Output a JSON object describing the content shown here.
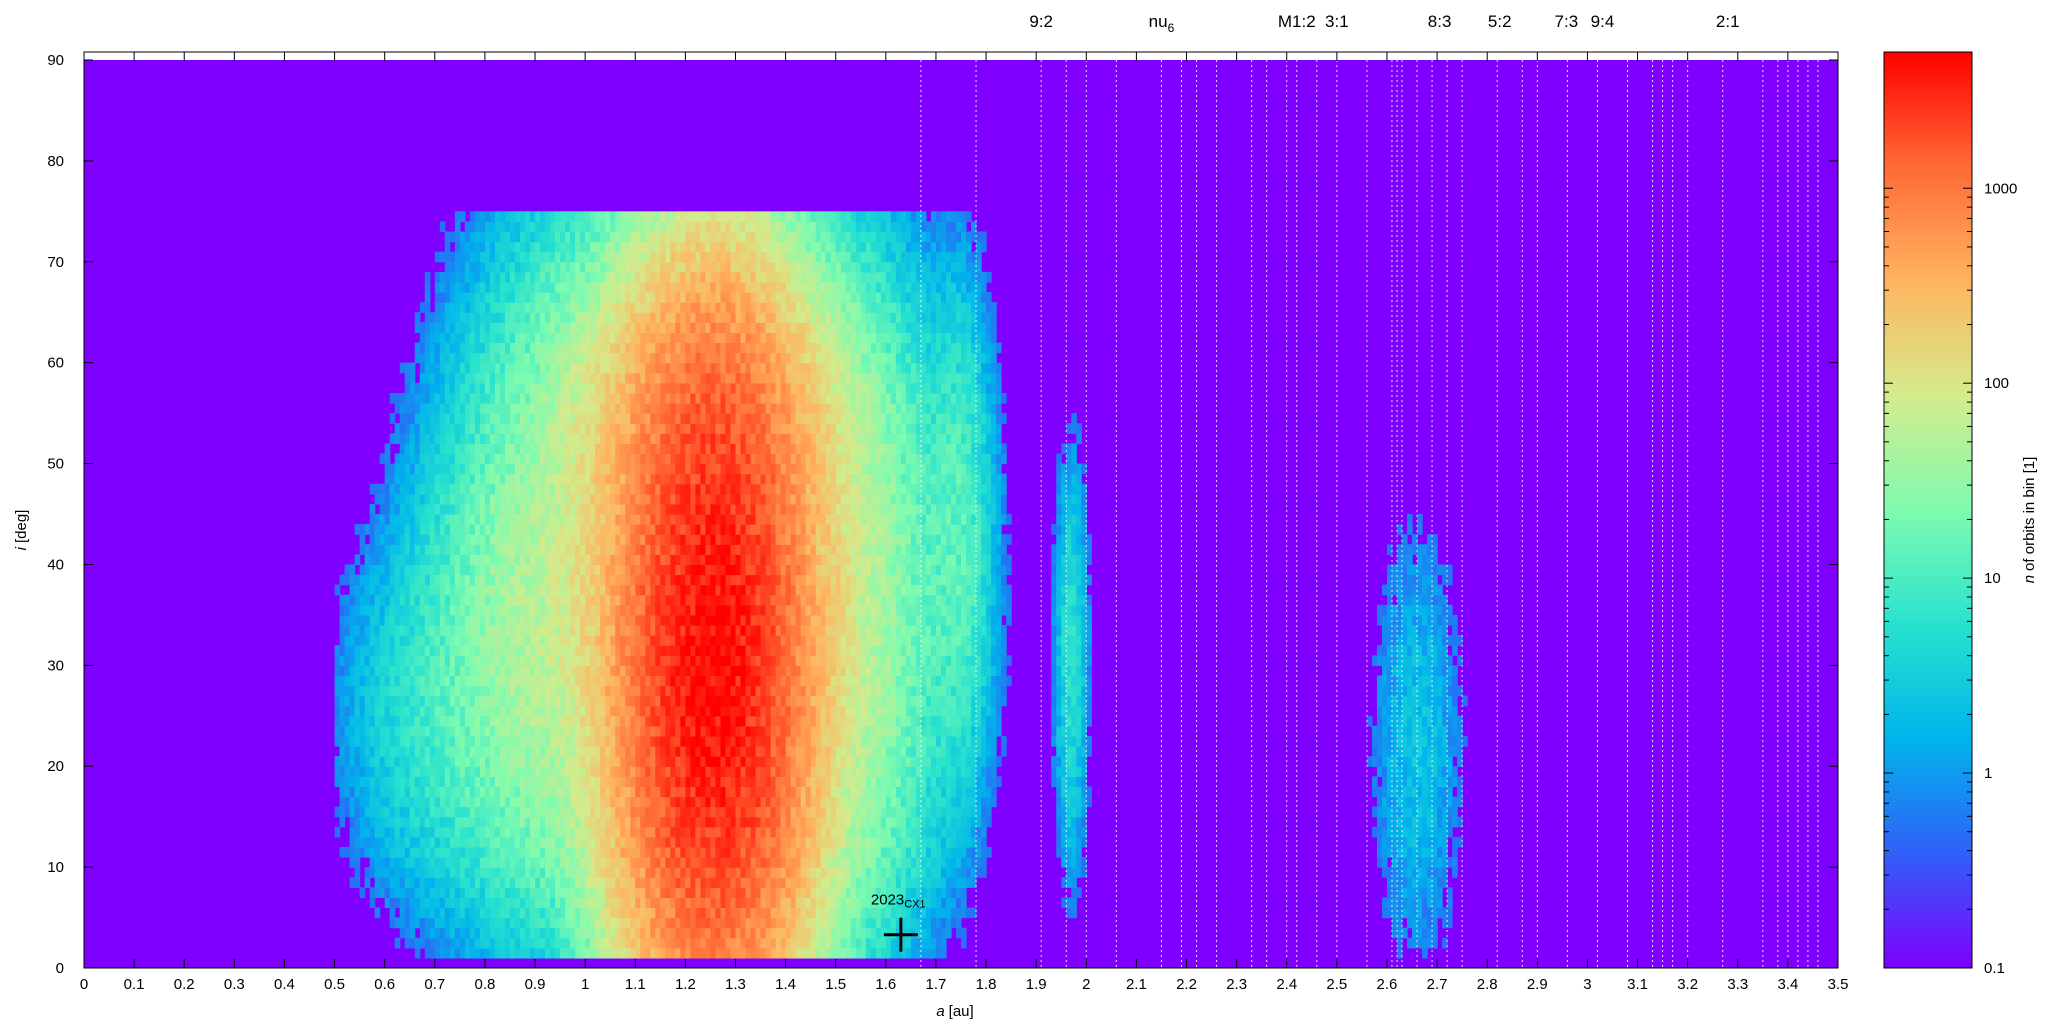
{
  "chart_data": {
    "type": "heatmap",
    "xlabel_var": "a",
    "xlabel_unit": "[au]",
    "ylabel_var": "i",
    "ylabel_unit": "[deg]",
    "colorbar_label_var": "n",
    "colorbar_label_text": "of orbits in bin [1]",
    "xlim": [
      0,
      3.5
    ],
    "ylim": [
      0,
      90
    ],
    "x_ticks": [
      "0",
      "0.1",
      "0.2",
      "0.3",
      "0.4",
      "0.5",
      "0.6",
      "0.7",
      "0.8",
      "0.9",
      "1",
      "1.1",
      "1.2",
      "1.3",
      "1.4",
      "1.5",
      "1.6",
      "1.7",
      "1.8",
      "1.9",
      "2",
      "2.1",
      "2.2",
      "2.3",
      "2.4",
      "2.5",
      "2.6",
      "2.7",
      "2.8",
      "2.9",
      "3",
      "3.1",
      "3.2",
      "3.3",
      "3.4",
      "3.5"
    ],
    "y_ticks": [
      "0",
      "10",
      "20",
      "30",
      "40",
      "50",
      "60",
      "70",
      "80",
      "90"
    ],
    "colorbar": {
      "scale": "log",
      "range": [
        0.1,
        5000
      ],
      "ticks": [
        {
          "value": 0.1,
          "label": "0.1"
        },
        {
          "value": 1,
          "label": "1"
        },
        {
          "value": 10,
          "label": "10"
        },
        {
          "value": 100,
          "label": "100"
        },
        {
          "value": 1000,
          "label": "1000"
        }
      ],
      "colors": [
        "#7f00ff",
        "#3060f8",
        "#00b4eb",
        "#28e2ce",
        "#7ffbb0",
        "#d4eb8c",
        "#ffb460",
        "#ff6a36",
        "#ff0000"
      ]
    },
    "background_color": "#7f00ff",
    "resonance_labels": [
      {
        "a": 1.91,
        "text": "9:2"
      },
      {
        "a": 2.15,
        "text": "nu",
        "sub": "6"
      },
      {
        "a": 2.42,
        "text": "M1:2"
      },
      {
        "a": 2.5,
        "text": "3:1"
      },
      {
        "a": 2.705,
        "text": "8:3"
      },
      {
        "a": 2.825,
        "text": "5:2"
      },
      {
        "a": 2.958,
        "text": "7:3"
      },
      {
        "a": 3.03,
        "text": "9:4"
      },
      {
        "a": 3.28,
        "text": "2:1"
      }
    ],
    "resonance_lines_a": [
      1.67,
      1.78,
      1.91,
      1.96,
      2.0,
      2.06,
      2.15,
      2.19,
      2.22,
      2.26,
      2.33,
      2.36,
      2.4,
      2.42,
      2.46,
      2.5,
      2.56,
      2.61,
      2.62,
      2.63,
      2.66,
      2.69,
      2.72,
      2.75,
      2.82,
      2.87,
      2.9,
      2.96,
      3.02,
      3.08,
      3.13,
      3.15,
      3.17,
      3.2,
      3.27,
      3.35,
      3.38,
      3.4,
      3.42,
      3.44,
      3.46
    ],
    "marker": {
      "name": "2023 CX1",
      "label_main": "2023",
      "label_sub": "CX1",
      "a": 1.63,
      "i": 3.3
    },
    "clusters": [
      {
        "a": 1.255,
        "i": 30,
        "sa": 0.09,
        "si": 16,
        "peak": 4500
      },
      {
        "a": 1.25,
        "i": 55,
        "sa": 0.12,
        "si": 7,
        "peak": 350
      },
      {
        "a": 1.1,
        "i": 40,
        "sa": 0.15,
        "si": 16,
        "peak": 90
      },
      {
        "a": 1.42,
        "i": 38,
        "sa": 0.13,
        "si": 16,
        "peak": 70
      },
      {
        "a": 0.88,
        "i": 30,
        "sa": 0.1,
        "si": 12,
        "peak": 25
      },
      {
        "a": 0.68,
        "i": 25,
        "sa": 0.09,
        "si": 10,
        "peak": 5
      },
      {
        "a": 1.55,
        "i": 32,
        "sa": 0.07,
        "si": 16,
        "peak": 15
      },
      {
        "a": 1.25,
        "i": 12,
        "sa": 0.15,
        "si": 3,
        "peak": 40
      },
      {
        "a": 1.745,
        "i": 42,
        "sa": 0.035,
        "si": 13,
        "peak": 12
      },
      {
        "a": 1.97,
        "i": 30,
        "sa": 0.018,
        "si": 11,
        "peak": 6
      },
      {
        "a": 2.66,
        "i": 22,
        "sa": 0.05,
        "si": 12,
        "peak": 2.5
      }
    ]
  }
}
